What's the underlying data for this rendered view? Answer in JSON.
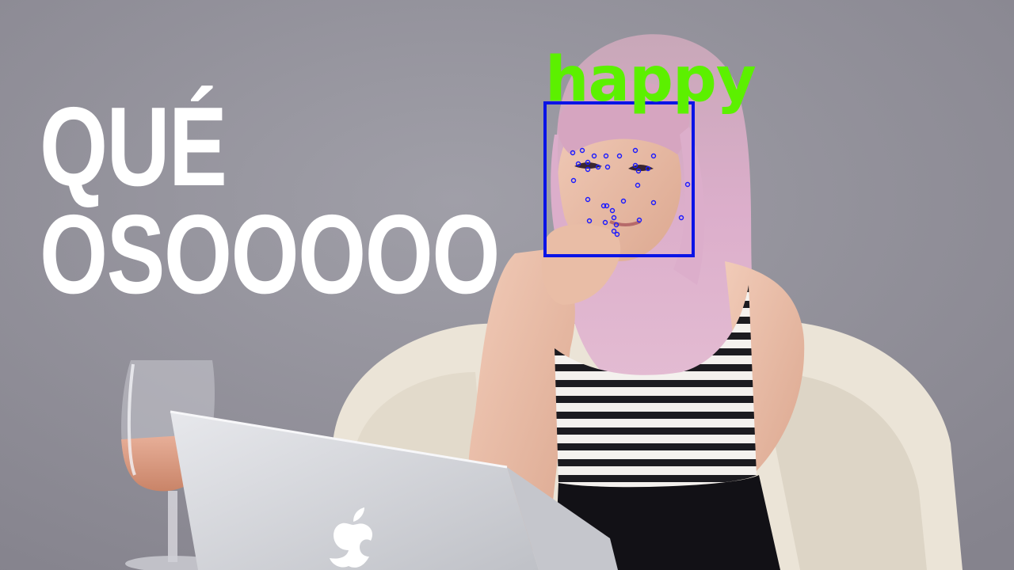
{
  "overlay": {
    "caption_lines": [
      "QUÉ",
      "OSOOOOO"
    ],
    "emotion_label": "happy",
    "label_color": "#5cf000",
    "box_color": "#0a14e6",
    "landmark_color": "#1a1aff"
  },
  "scene": {
    "background_color": "#8f8d97",
    "hair_color": "#d9a9c3",
    "chair_color": "#ece6da",
    "laptop_color": "#d8d9dd"
  }
}
